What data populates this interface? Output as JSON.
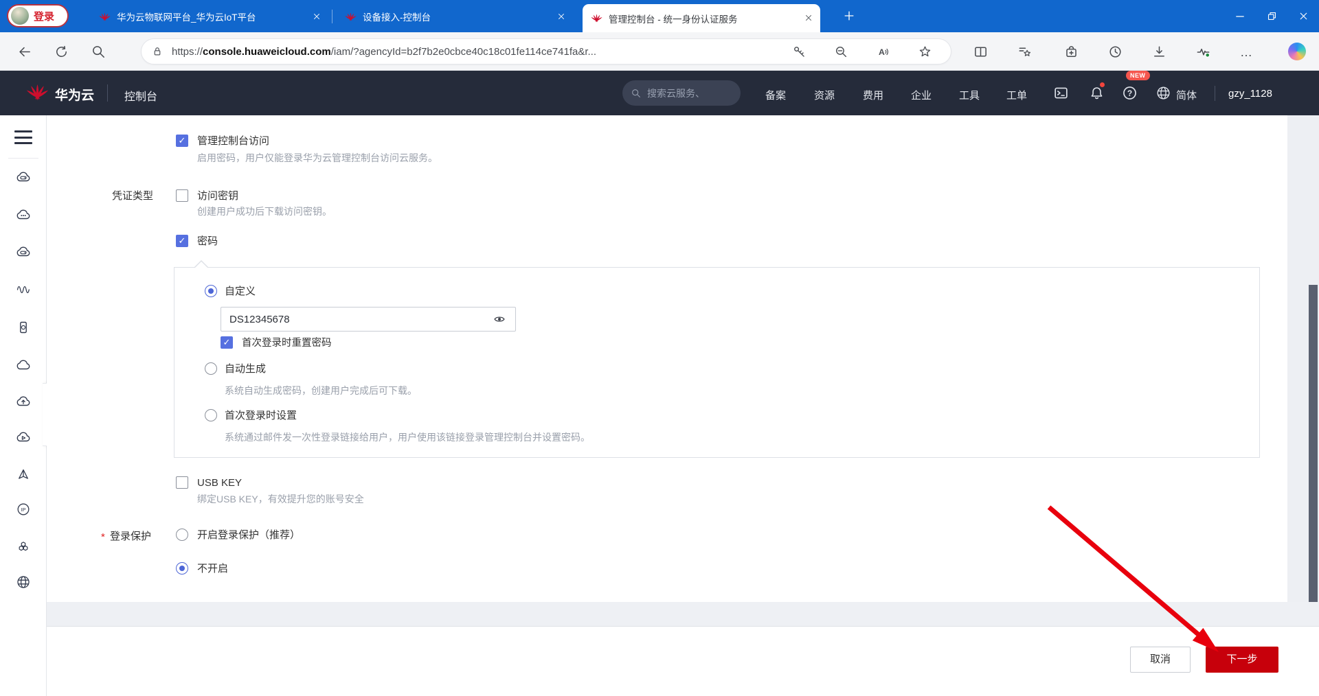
{
  "window": {
    "profile_label": "登录",
    "tabs": [
      {
        "title": "华为云物联网平台_华为云IoT平台",
        "active": false
      },
      {
        "title": "设备接入-控制台",
        "active": false
      },
      {
        "title": "管理控制台 - 统一身份认证服务",
        "active": true
      }
    ],
    "url": {
      "scheme": "https://",
      "domain": "console.huaweicloud.com",
      "path": "/iam/?agencyId=b2f7b2e0cbce40c18c01fe114ce741fa&r..."
    }
  },
  "header": {
    "brand": "华为云",
    "console": "控制台",
    "search_placeholder": "搜索云服务、",
    "nav": [
      "备案",
      "资源",
      "费用",
      "企业",
      "工具",
      "工单"
    ],
    "new_badge": "NEW",
    "language": "简体",
    "username": "gzy_1128"
  },
  "sidebar": {
    "icons": [
      "cloud-server-icon",
      "cloud-ellipsis-icon",
      "cloud-storage-icon",
      "wave-icon",
      "device-cloud-icon",
      "cloud-icon",
      "cloud-upload-icon",
      "cloud-play-icon",
      "pyramid-icon",
      "ip-icon",
      "hexagon-cluster-icon",
      "globe-icon"
    ]
  },
  "form": {
    "console_access": {
      "label": "管理控制台访问",
      "checked": true,
      "desc": "启用密码，用户仅能登录华为云管理控制台访问云服务。"
    },
    "credential_type": "凭证类型",
    "access_key": {
      "label": "访问密钥",
      "checked": false,
      "desc": "创建用户成功后下载访问密钥。"
    },
    "password": {
      "label": "密码",
      "checked": true
    },
    "custom": {
      "label": "自定义",
      "selected": true,
      "value": "DS12345678",
      "reset_label": "首次登录时重置密码",
      "reset_checked": true
    },
    "auto": {
      "label": "自动生成",
      "selected": false,
      "desc": "系统自动生成密码，创建用户完成后可下载。"
    },
    "first_login": {
      "label": "首次登录时设置",
      "selected": false,
      "desc": "系统通过邮件发一次性登录链接给用户，用户使用该链接登录管理控制台并设置密码。"
    },
    "usb_key": {
      "label": "USB KEY",
      "checked": false,
      "desc": "绑定USB KEY，有效提升您的账号安全"
    },
    "login_protection": {
      "required_mark": "*",
      "label": "登录保护",
      "enable": "开启登录保护（推荐）",
      "disable": "不开启",
      "selected": "不开启"
    },
    "cancel": "取消",
    "next": "下一步"
  },
  "colors": {
    "accent": "#5670e0",
    "next_button": "#c7000b",
    "titlebar": "#1167cd",
    "console_header": "#252b3a",
    "arrow": "#e8000d",
    "huawei_red": "#ce0e2d"
  }
}
